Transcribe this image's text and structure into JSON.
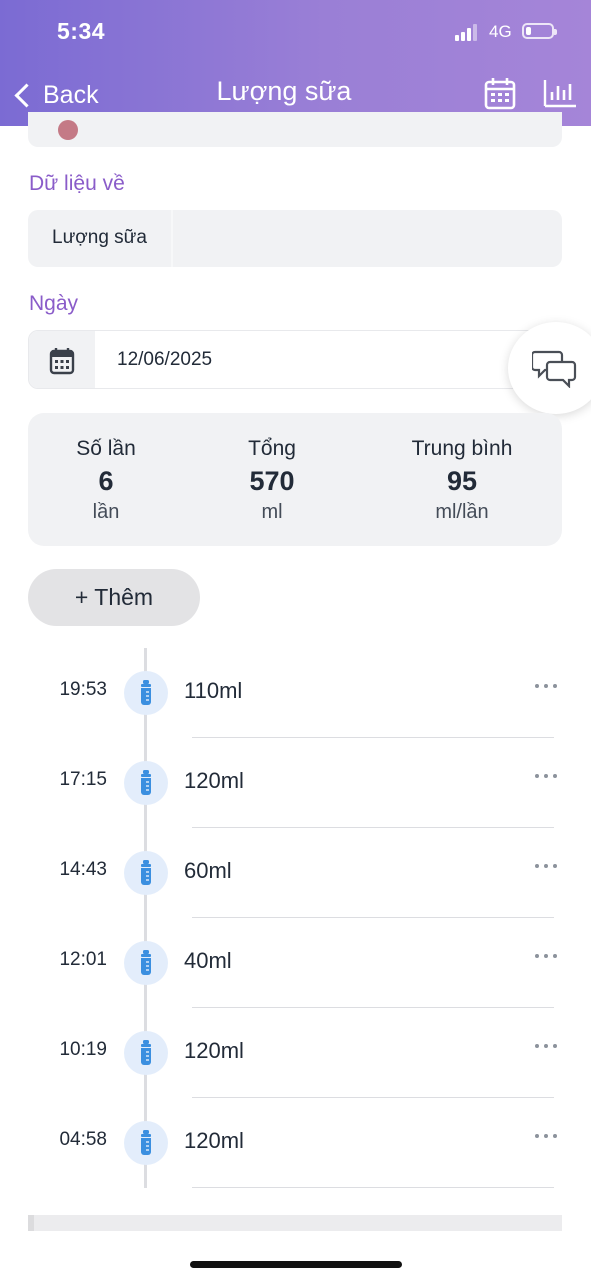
{
  "status_bar": {
    "time": "5:34",
    "network": "4G",
    "battery_level": 0.2
  },
  "header": {
    "back_label": "Back",
    "title": "Lượng sữa",
    "icons": [
      "calendar-icon",
      "bar-chart-icon"
    ]
  },
  "form": {
    "data_label": "Dữ liệu về",
    "data_value": "Lượng sữa",
    "date_label": "Ngày",
    "date_value": "12/06/2025"
  },
  "stats": {
    "count": {
      "label": "Số lần",
      "value": "6",
      "unit": "lần"
    },
    "total": {
      "label": "Tổng",
      "value": "570",
      "unit": "ml"
    },
    "average": {
      "label": "Trung bình",
      "value": "95",
      "unit": "ml/lần"
    }
  },
  "add_button_label": "+ Thêm",
  "entries": [
    {
      "time": "19:53",
      "amount": "110ml"
    },
    {
      "time": "17:15",
      "amount": "120ml"
    },
    {
      "time": "14:43",
      "amount": "60ml"
    },
    {
      "time": "12:01",
      "amount": "40ml"
    },
    {
      "time": "10:19",
      "amount": "120ml"
    },
    {
      "time": "04:58",
      "amount": "120ml"
    }
  ],
  "colors": {
    "header_gradient_start": "#7b6bd3",
    "header_gradient_end": "#a585d8",
    "accent_label": "#8a5cc9",
    "bottle_icon": "#3b8fe0"
  }
}
